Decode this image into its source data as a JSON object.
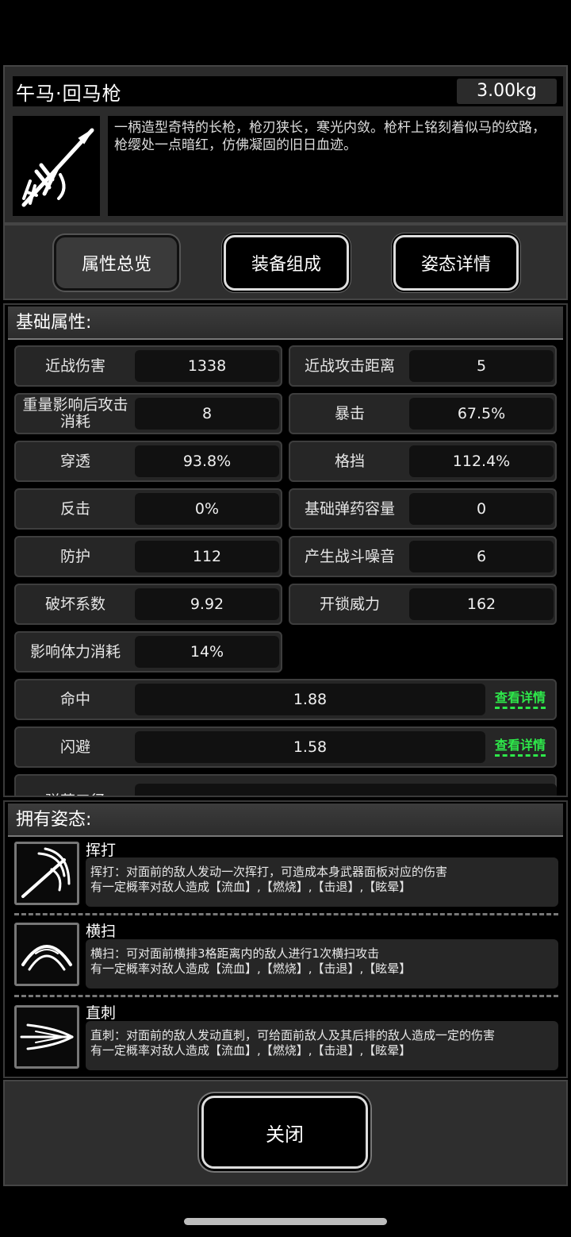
{
  "item": {
    "name": "午马·回马枪",
    "weight": "3.00kg",
    "icon": "spear-icon",
    "description": "一柄造型奇特的长枪，枪刃狭长，寒光内敛。枪杆上铭刻着似马的纹路，枪缨处一点暗红，仿佛凝固的旧日血迹。"
  },
  "tabs": [
    {
      "label": "属性总览",
      "active": true
    },
    {
      "label": "装备组成",
      "active": false
    },
    {
      "label": "姿态详情",
      "active": false
    }
  ],
  "attributes": {
    "section_title": "基础属性:",
    "items": [
      {
        "label": "近战伤害",
        "value": "1338"
      },
      {
        "label": "近战攻击距离",
        "value": "5"
      },
      {
        "label": "重量影响后攻击消耗",
        "value": "8"
      },
      {
        "label": "暴击",
        "value": "67.5%"
      },
      {
        "label": "穿透",
        "value": "93.8%"
      },
      {
        "label": "格挡",
        "value": "112.4%"
      },
      {
        "label": "反击",
        "value": "0%"
      },
      {
        "label": "基础弹药容量",
        "value": "0"
      },
      {
        "label": "防护",
        "value": "112"
      },
      {
        "label": "产生战斗噪音",
        "value": "6"
      },
      {
        "label": "破坏系数",
        "value": "9.92"
      },
      {
        "label": "开锁威力",
        "value": "162"
      },
      {
        "label": "影响体力消耗",
        "value": "14%"
      }
    ],
    "wide_items": [
      {
        "label": "命中",
        "value": "1.88",
        "link": "查看详情"
      },
      {
        "label": "闪避",
        "value": "1.58",
        "link": "查看详情"
      },
      {
        "label": "弹药口径",
        "value": "---"
      }
    ]
  },
  "stances": {
    "section_title": "拥有姿态:",
    "items": [
      {
        "name": "挥打",
        "icon": "swing-slash-icon",
        "line1": "挥打：对面前的敌人发动一次挥打，可造成本身武器面板对应的伤害",
        "line2": "有一定概率对敌人造成【流血】,【燃烧】,【击退】,【眩晕】"
      },
      {
        "name": "横扫",
        "icon": "sweep-arc-icon",
        "line1": "横扫：可对面前横排3格距离内的敌人进行1次横扫攻击",
        "line2": "有一定概率对敌人造成【流血】,【燃烧】,【击退】,【眩晕】"
      },
      {
        "name": "直刺",
        "icon": "thrust-icon",
        "line1": "直刺：对面前的敌人发动直刺，可给面前敌人及其后排的敌人造成一定的伤害",
        "line2": "有一定概率对敌人造成【流血】,【燃烧】,【击退】,【眩晕】"
      }
    ]
  },
  "close_label": "关闭",
  "colors": {
    "accent_link": "#2ee84a",
    "panel": "#2a2a2a",
    "background": "#000000"
  }
}
